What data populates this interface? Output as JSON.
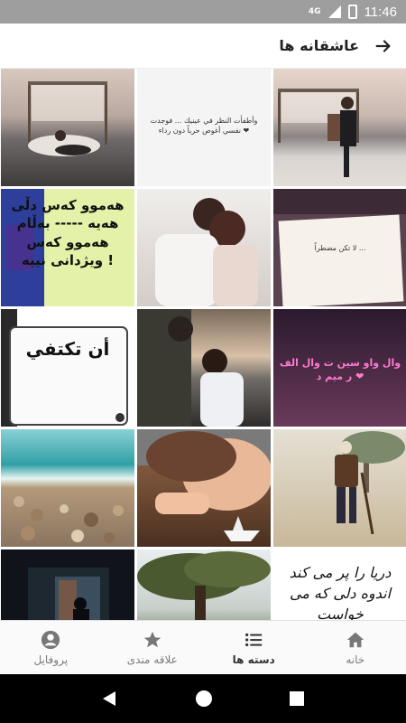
{
  "status_bar": {
    "network": "4G",
    "time": "11:46"
  },
  "header": {
    "title": "عاشقانه ها"
  },
  "grid_tiles": [
    {
      "name": "beach-couple-tile",
      "caption": ""
    },
    {
      "name": "arabic-note-tile",
      "caption": "وأطفأت النظر في عينيك ... فوجدت نفسي أغوص حرباً دون رداء ❤"
    },
    {
      "name": "beach-hug-tile",
      "caption": ""
    },
    {
      "name": "kurdish-text-tile",
      "caption": "هەموو کەس دڵی هەیە ----- بەڵام هەموو کەس ویژدانی نییە !"
    },
    {
      "name": "couple-kiss-tile",
      "caption": ""
    },
    {
      "name": "book-page-tile",
      "caption": "لا تكن مضطراً ..."
    },
    {
      "name": "sign-tile",
      "caption": "أن تكتفي"
    },
    {
      "name": "couple-forehead-tile",
      "caption": ""
    },
    {
      "name": "neon-text-tile",
      "caption": "وال واو سين ت وال الف ر ميم د ❤"
    },
    {
      "name": "pebble-beach-tile",
      "caption": ""
    },
    {
      "name": "child-paper-boat-tile",
      "caption": ""
    },
    {
      "name": "old-man-tile",
      "caption": ""
    },
    {
      "name": "window-silhouette-tile",
      "caption": ""
    },
    {
      "name": "tree-landscape-tile",
      "caption": ""
    },
    {
      "name": "persian-poem-tile",
      "caption": "دریا را پر می کند اندوه دلی که می خواست"
    }
  ],
  "bottom_nav": {
    "items": [
      {
        "label": "خانه",
        "icon": "home-icon"
      },
      {
        "label": "دسته ها",
        "icon": "list-icon",
        "active": true
      },
      {
        "label": "علاقه مندی",
        "icon": "star-icon"
      },
      {
        "label": "پروفایل",
        "icon": "profile-icon"
      }
    ]
  },
  "colors": {
    "status_bar": "#9e9e9e",
    "bottom_nav_bg": "#fafafa",
    "system_nav_bg": "#000000"
  }
}
